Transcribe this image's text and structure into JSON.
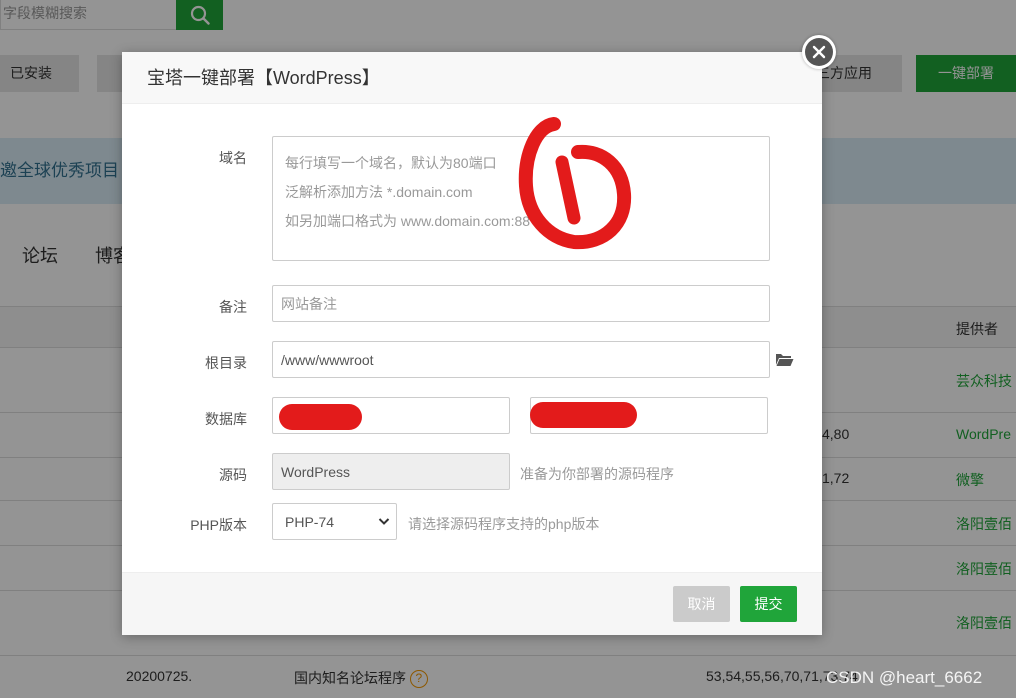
{
  "background": {
    "search_placeholder": "字段模糊搜索",
    "tab_installed": "已安装",
    "tab_third": "三方应用",
    "deploy_button": "一键部署",
    "banner_text": "邀全球优秀项目",
    "categories": [
      "论坛",
      "博客"
    ],
    "provider_header": "提供者",
    "rows": [
      {
        "php": "",
        "provider": "芸众科技"
      },
      {
        "php": "4,80",
        "provider": "WordPre"
      },
      {
        "php": "1,72",
        "provider": "微擎"
      },
      {
        "php": "",
        "provider": "洛阳壹佰"
      },
      {
        "php": "",
        "provider": "洛阳壹佰"
      },
      {
        "php": "",
        "provider": "洛阳壹佰"
      }
    ],
    "last_row": {
      "version": "20200725.",
      "description": "国内知名论坛程序",
      "php": "53,54,55,56,70,71,73,74"
    },
    "help_glyph": "?"
  },
  "watermark": "CSDN @heart_6662",
  "modal": {
    "title": "宝塔一键部署【WordPress】",
    "domain_label": "域名",
    "domain_placeholder": "每行填写一个域名，默认为80端口\n泛解析添加方法 *.domain.com\n如另加端口格式为 www.domain.com:88",
    "remark_label": "备注",
    "remark_placeholder": "网站备注",
    "root_label": "根目录",
    "root_value": "/www/wwwroot",
    "database_label": "数据库",
    "source_label": "源码",
    "source_value": "WordPress",
    "source_hint": "准备为你部署的源码程序",
    "php_label": "PHP版本",
    "php_selected": "PHP-74",
    "php_hint": "请选择源码程序支持的php版本",
    "cancel_label": "取消",
    "submit_label": "提交"
  },
  "colors": {
    "brand_green": "#20a53a",
    "annotation_red": "#e31b1b"
  },
  "icons": [
    "search-icon",
    "close-icon",
    "folder-icon",
    "chevron-down-icon",
    "help-icon"
  ]
}
